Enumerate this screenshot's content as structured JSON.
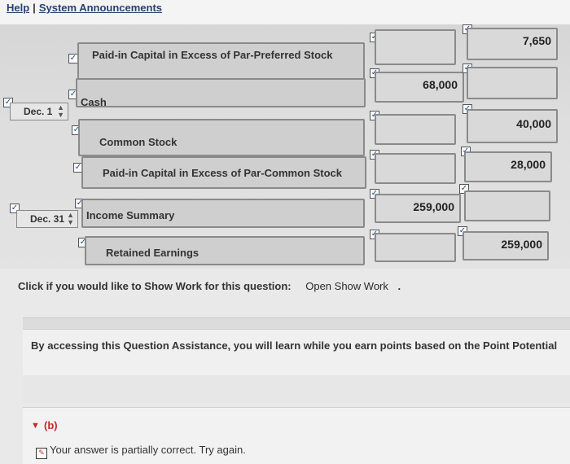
{
  "topnav": {
    "help": "Help",
    "separator": "|",
    "announcements": "System Announcements"
  },
  "journal": {
    "rows": [
      {
        "date": "",
        "account": "Paid-in Capital in Excess of Par-Preferred Stock",
        "debit": "",
        "credit": "7,650"
      },
      {
        "date": "Dec. 1",
        "account": "Cash",
        "debit": "68,000",
        "credit": ""
      },
      {
        "date": "",
        "account": "Common Stock",
        "debit": "",
        "credit": "40,000"
      },
      {
        "date": "",
        "account": "Paid-in Capital in Excess of Par-Common Stock",
        "debit": "",
        "credit": "28,000"
      },
      {
        "date": "Dec. 31",
        "account": "Income Summary",
        "debit": "259,000",
        "credit": ""
      },
      {
        "date": "",
        "account": "Retained Earnings",
        "debit": "",
        "credit": "259,000"
      }
    ]
  },
  "show_work": {
    "prompt": "Click if you would like to Show Work for this question:",
    "link": "Open Show Work",
    "dot": "."
  },
  "assistance": {
    "text": "By accessing this Question Assistance, you will learn while you earn points based on the Point Potential"
  },
  "part_b": {
    "label": "(b)",
    "status": "Your answer is partially correct.  Try again."
  },
  "colors": {
    "field_bg": "#d4d4d4",
    "field_border": "#8a8a8a",
    "link_blue": "#2a3f6e",
    "part_label_red": "#c62828"
  },
  "icons": {
    "check": "checkmark-icon",
    "spinner": "spinner-arrows-icon",
    "collapse": "triangle-down-icon",
    "edit": "pencil-icon"
  }
}
